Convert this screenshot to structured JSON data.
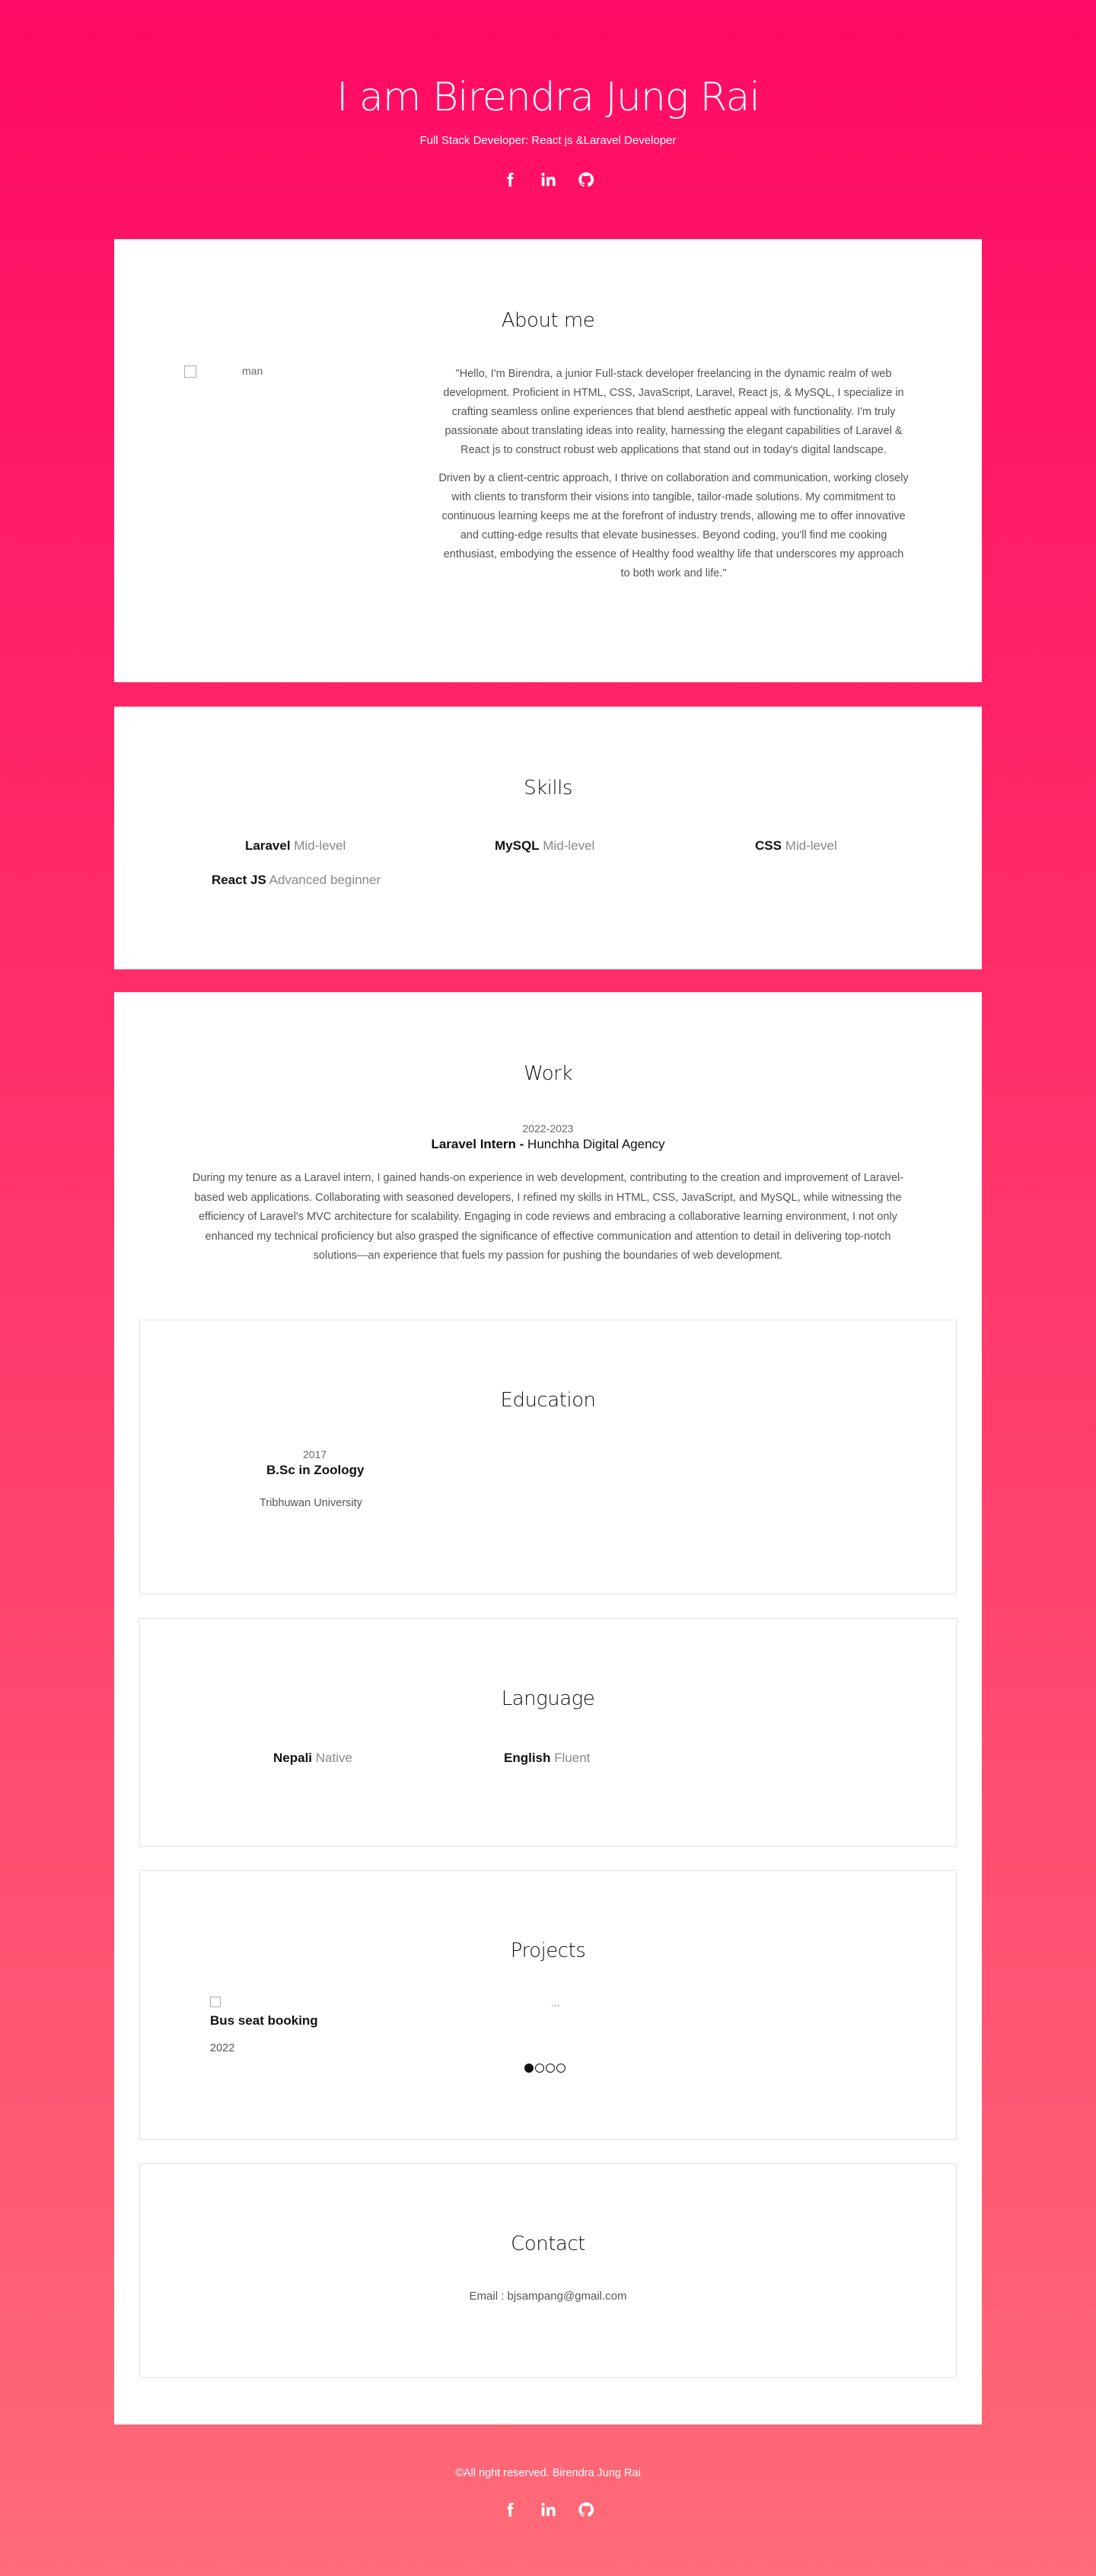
{
  "header": {
    "title": "I am Birendra Jung Rai",
    "subtitle": "Full Stack Developer: React js &Laravel Developer"
  },
  "social": [
    {
      "name": "facebook-icon",
      "label": "facebook"
    },
    {
      "name": "linkedin-icon",
      "label": "linkedin"
    },
    {
      "name": "github-icon",
      "label": "github"
    }
  ],
  "about": {
    "title": "About me",
    "image_alt": "man",
    "paragraphs": [
      "\"Hello, I'm Birendra, a junior Full-stack developer freelancing in the dynamic realm of web development. Proficient in HTML, CSS, JavaScript, Laravel, React js, & MySQL, I specialize in crafting seamless online experiences that blend aesthetic appeal with functionality. I'm truly passionate about translating ideas into reality, harnessing the elegant capabilities of Laravel & React js to construct robust web applications that stand out in today's digital landscape.",
      "Driven by a client-centric approach, I thrive on collaboration and communication, working closely with clients to transform their visions into tangible, tailor-made solutions. My commitment to continuous learning keeps me at the forefront of industry trends, allowing me to offer innovative and cutting-edge results that elevate businesses. Beyond coding, you'll find me cooking enthusiast, embodying the essence of Healthy food wealthy life that underscores my approach to both work and life.\""
    ]
  },
  "skills": {
    "title": "Skills",
    "items": [
      {
        "name": "Laravel",
        "level": "Mid-level"
      },
      {
        "name": "MySQL",
        "level": "Mid-level"
      },
      {
        "name": "CSS",
        "level": "Mid-level"
      },
      {
        "name": "React JS",
        "level": "Advanced beginner"
      }
    ]
  },
  "work": {
    "title": "Work",
    "year": "2022-2023",
    "role": "Laravel Intern -",
    "company": "Hunchha Digital Agency",
    "description": "During my tenure as a Laravel intern, I gained hands-on experience in web development, contributing to the creation and improvement of Laravel-based web applications. Collaborating with seasoned developers, I refined my skills in HTML, CSS, JavaScript, and MySQL, while witnessing the efficiency of Laravel's MVC architecture for scalability. Engaging in code reviews and embracing a collaborative learning environment, I not only enhanced my technical proficiency but also grasped the significance of effective communication and attention to detail in delivering top-notch solutions—an experience that fuels my passion for pushing the boundaries of web development."
  },
  "education": {
    "title": "Education",
    "year": "2017",
    "degree": "B.Sc in Zoology",
    "university": "Tribhuwan University"
  },
  "language": {
    "title": "Language",
    "items": [
      {
        "name": "Nepali",
        "level": "Native"
      },
      {
        "name": "English",
        "level": "Fluent"
      }
    ]
  },
  "projects": {
    "title": "Projects",
    "name": "Bus seat booking",
    "year": "2022",
    "placeholder": "..."
  },
  "contact": {
    "title": "Contact",
    "email": "Email : bjsampang@gmail.com"
  },
  "footer": {
    "copyright": "©All right reserved. Birendra Jung Rai"
  }
}
